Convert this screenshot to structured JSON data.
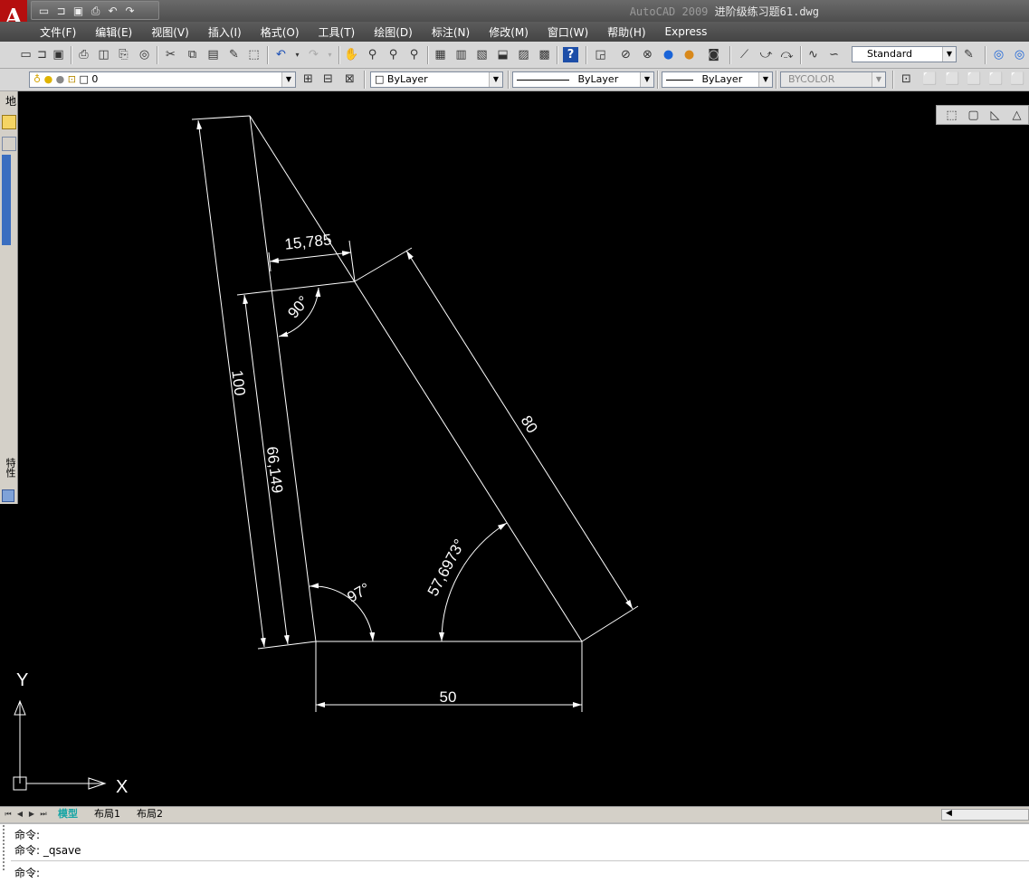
{
  "window": {
    "app_name": "AutoCAD 2009",
    "file_name": "进阶级练习题61.dwg"
  },
  "app_logo": "A",
  "menu": [
    "文件(F)",
    "编辑(E)",
    "视图(V)",
    "插入(I)",
    "格式(O)",
    "工具(T)",
    "绘图(D)",
    "标注(N)",
    "修改(M)",
    "窗口(W)",
    "帮助(H)",
    "Express"
  ],
  "toolbar": {
    "text_style": "Standard",
    "layer": "0",
    "color": "ByLayer",
    "linetype": "ByLayer",
    "lineweight": "ByLayer",
    "plotstyle": "BYCOLOR"
  },
  "left_palette": {
    "label_top": "地",
    "label_side": "特性"
  },
  "drawing": {
    "dimensions": {
      "top_width": "15,785",
      "right_angle": "90°",
      "left_length": "100",
      "inner_length": "66,149",
      "hypotenuse": "80",
      "angle_right": "57,6973°",
      "angle_left": "97°",
      "base": "50"
    },
    "ucs": {
      "y_label": "Y",
      "x_label": "X"
    }
  },
  "layout_tabs": [
    "模型",
    "布局1",
    "布局2"
  ],
  "active_tab": "模型",
  "command_lines": [
    "命令:",
    "命令: _qsave",
    "命令:"
  ]
}
